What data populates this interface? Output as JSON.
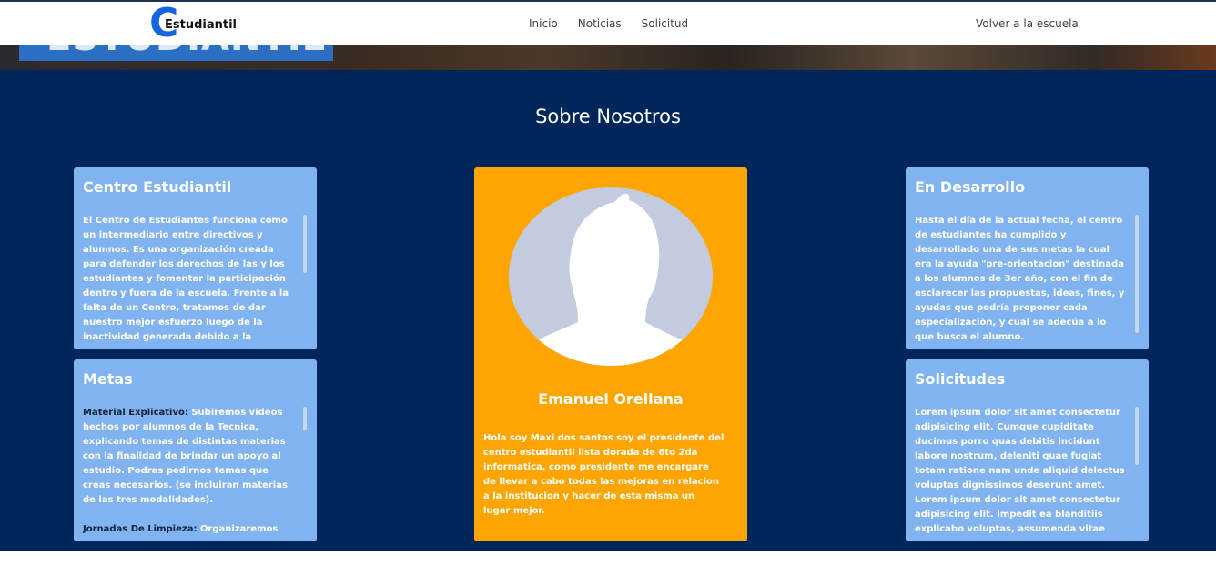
{
  "nav": {
    "logo_letter": "C",
    "logo_text": "Estudiantil",
    "links": [
      "Inicio",
      "Noticias",
      "Solicitud"
    ],
    "right_link": "Volver a la escuela"
  },
  "hero": {
    "banner_text": "ESTUDIANTIL"
  },
  "about": {
    "title": "Sobre Nosotros",
    "card_centro": {
      "title": "Centro Estudiantil",
      "text": "El Centro de Estudiantes funciona como un intermediario entre directivos y alumnos. Es una organización creada para defender los derechos de las y los estudiantes y fomentar la participación dentro y fuera de la escuela. Frente a la falta de un Centro, tratamos de dar nuestro mejor esfuerzo luego de la inactividad generada debido a la"
    },
    "card_metas": {
      "title": "Metas",
      "item1_label": "Material Explicativo:",
      "item1_text": " Subiremos videos hechos por alumnos de la Tecnica, explicando temas de distintas materias con la finalidad de brindar un apoyo al estudio. Podras pedirnos temas que creas necesarios. (se incluiran materias de las tres modalidades).",
      "item2_label": "Jornadas De Limpieza:",
      "item2_text": " Organizaremos"
    },
    "card_desarrollo": {
      "title": "En Desarrollo",
      "text": "Hasta el día de la actual fecha, el centro de estudiantes ha cumplido y desarrollado una de sus metas la cual era la ayuda \"pre-orientacion\" destinada a los alumnos de 3er año, con el fin de esclarecer las propuestas, ideas, fines, y ayudas que podría proponer cada especialización, y cual se adecúa a lo que busca el alumno."
    },
    "card_solicitudes": {
      "title": "Solicitudes",
      "text": "Lorem ipsum dolor sit amet consectetur adipisicing elit. Cumque cupiditate ducimus porro quas debitis incidunt labore nostrum, deleniti quae fugiat totam ratione nam unde aliquid delectus voluptas dignissimos deserunt amet. Lorem ipsum dolor sit amet consectetur adipisicing elit. Impedit ea blanditiis explicabo voluptas, assumenda vitae"
    },
    "profile": {
      "name": "Emanuel Orellana",
      "bio": "Hola soy Maxi dos santos soy el presidente del centro estudiantil lista dorada de 6to 2da informatica, como presidente me encargare de llevar a cabo todas las mejoras en relacion a la institucion y hacer de esta misma un lugar mejor."
    }
  },
  "colors": {
    "section_bg": "#00265c",
    "card_bg": "#80b3f0",
    "profile_bg": "#ffa501",
    "logo_accent": "#1565e0"
  },
  "icons": {
    "avatar": "user-silhouette-icon"
  }
}
